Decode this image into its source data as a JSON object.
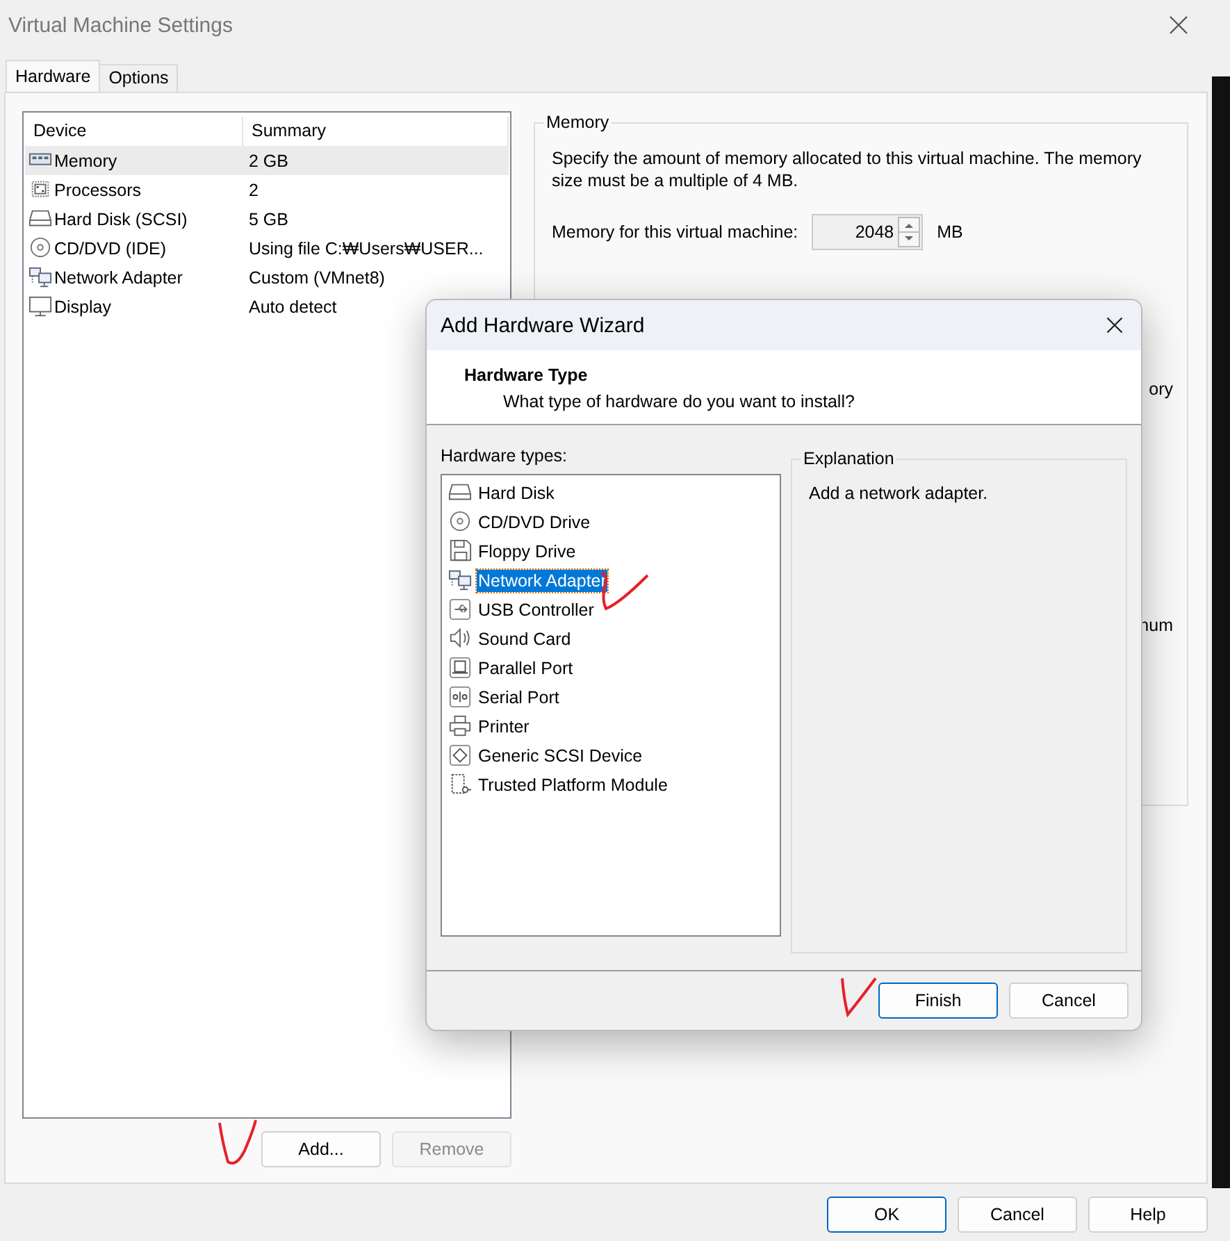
{
  "window": {
    "title": "Virtual Machine Settings"
  },
  "tabs": [
    {
      "label": "Hardware",
      "selected": true
    },
    {
      "label": "Options",
      "selected": false
    }
  ],
  "devices": {
    "columns": [
      "Device",
      "Summary"
    ],
    "rows": [
      {
        "kind": "memory",
        "device": "Memory",
        "summary": "2 GB",
        "selected": true
      },
      {
        "kind": "processor",
        "device": "Processors",
        "summary": "2",
        "selected": false
      },
      {
        "kind": "disk",
        "device": "Hard Disk (SCSI)",
        "summary": "5 GB",
        "selected": false
      },
      {
        "kind": "disc",
        "device": "CD/DVD (IDE)",
        "summary": "Using file C:₩Users₩USER...",
        "selected": false
      },
      {
        "kind": "network",
        "device": "Network Adapter",
        "summary": "Custom (VMnet8)",
        "selected": false
      },
      {
        "kind": "display",
        "device": "Display",
        "summary": "Auto detect",
        "selected": false
      }
    ]
  },
  "device_buttons": [
    {
      "label": "Add...",
      "disabled": false
    },
    {
      "label": "Remove",
      "disabled": true
    }
  ],
  "memory": {
    "title": "Memory",
    "description": "Specify the amount of memory allocated to this virtual machine. The memory size must be a multiple of 4 MB.",
    "field_label": "Memory for this virtual machine:",
    "value": "2048",
    "unit": "MB",
    "fragments": [
      "ory",
      "num"
    ]
  },
  "dialog": {
    "title": "Add Hardware Wizard",
    "heading": "Hardware Type",
    "subheading": "What type of hardware do you want to install?",
    "list_label": "Hardware types:",
    "types": [
      {
        "kind": "disk",
        "label": "Hard Disk",
        "selected": false
      },
      {
        "kind": "disc",
        "label": "CD/DVD Drive",
        "selected": false
      },
      {
        "kind": "floppy",
        "label": "Floppy Drive",
        "selected": false
      },
      {
        "kind": "network",
        "label": "Network Adapter",
        "selected": true
      },
      {
        "kind": "usb",
        "label": "USB Controller",
        "selected": false
      },
      {
        "kind": "sound",
        "label": "Sound Card",
        "selected": false
      },
      {
        "kind": "parallel",
        "label": "Parallel Port",
        "selected": false
      },
      {
        "kind": "serial",
        "label": "Serial Port",
        "selected": false
      },
      {
        "kind": "printer",
        "label": "Printer",
        "selected": false
      },
      {
        "kind": "scsi",
        "label": "Generic SCSI Device",
        "selected": false
      },
      {
        "kind": "tpm",
        "label": "Trusted Platform Module",
        "selected": false
      }
    ],
    "explanation_title": "Explanation",
    "explanation": "Add a network adapter.",
    "buttons": [
      {
        "label": "Finish",
        "default": true
      },
      {
        "label": "Cancel",
        "default": false
      }
    ]
  },
  "buttons": [
    {
      "label": "OK",
      "default": true
    },
    {
      "label": "Cancel",
      "default": false
    },
    {
      "label": "Help",
      "default": false
    }
  ]
}
